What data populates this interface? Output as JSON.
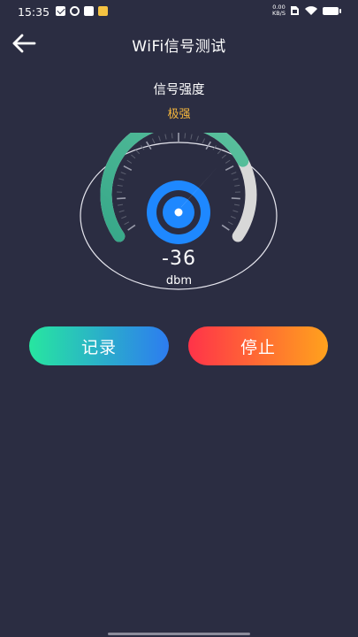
{
  "status_bar": {
    "time": "15:35",
    "net_speed_value": "0.00",
    "net_speed_unit": "KB/S",
    "icons": [
      "shield-check-icon",
      "sync-icon",
      "mail-icon",
      "folder-icon",
      "sim-icon",
      "wifi-icon",
      "battery-icon"
    ]
  },
  "header": {
    "title": "WiFi信号测试",
    "back_icon": "arrow-left-icon"
  },
  "signal": {
    "title": "信号强度",
    "level": "极强",
    "value": "-36",
    "unit": "dbm",
    "gauge_fraction": 0.75
  },
  "buttons": {
    "record_label": "记录",
    "stop_label": "停止"
  },
  "colors": {
    "background": "#2b2d42",
    "level_text": "#f6b73c",
    "gauge_active_start": "#3fb58f",
    "gauge_track": "#d8d8d8",
    "record_gradient": [
      "#27e6a0",
      "#2d7cf0"
    ],
    "stop_gradient": [
      "#ff3349",
      "#ffa21d"
    ],
    "center_blue": "#1e88ff"
  }
}
